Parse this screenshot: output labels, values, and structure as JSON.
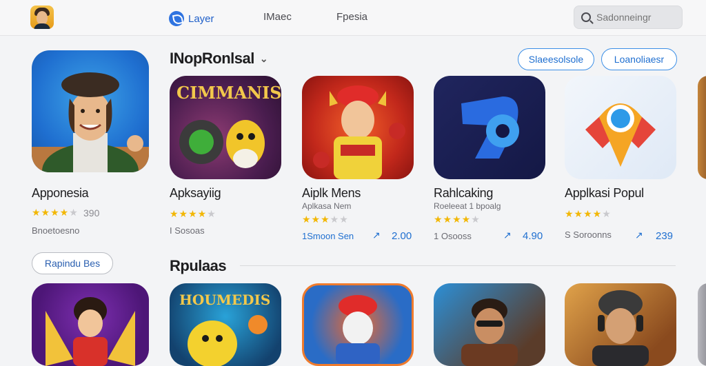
{
  "nav": {
    "items": [
      "Layer",
      "IMaec",
      "Fpesia"
    ],
    "search_placeholder": "Sadonneingr"
  },
  "featured": {
    "name": "Apponesia",
    "stars": 4,
    "rating": "390",
    "meta": "Bnoetoesno",
    "button": "Rapindu Bes"
  },
  "sections": {
    "first_title": "INopRonlsal",
    "pills": [
      "Slaeesolsole",
      "Loanoliaesr"
    ],
    "second_title": "Rpulaas"
  },
  "apps": [
    {
      "tile_text": "CIMMANIS",
      "name": "Apksayiig",
      "sub": "",
      "stars": 4,
      "meta": "I Sosoas",
      "metric": "",
      "trend": ""
    },
    {
      "tile_text": "",
      "name": "Aiplk Mens",
      "sub": "Aplkasa Nem",
      "stars": 3,
      "meta": "1Smoon Sen",
      "metric": "2.00",
      "trend": "↗"
    },
    {
      "tile_text": "",
      "name": "Rahlcaking",
      "sub": "Roeleeat 1 bpoalg",
      "stars": 4,
      "meta": "1 Osooss",
      "metric": "4.90",
      "trend": "↗"
    },
    {
      "tile_text": "",
      "name": "Applkasi Popul",
      "sub": "",
      "stars": 4,
      "meta": "S Soroonns",
      "metric": "239",
      "trend": "↗"
    }
  ],
  "bottom_tile_text": "HOUMEDIS",
  "colors": {
    "accent": "#1f6fd0",
    "star": "#f2b705",
    "background": "#f3f4f6"
  }
}
